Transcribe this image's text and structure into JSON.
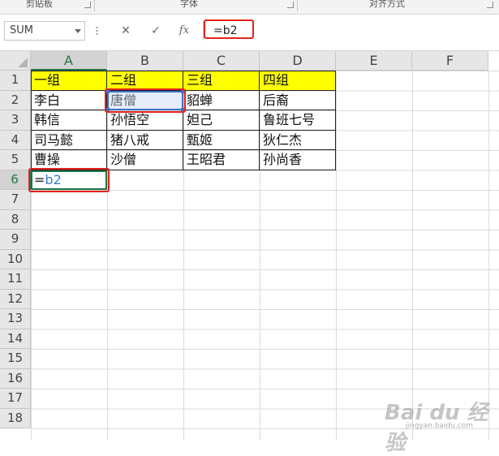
{
  "ribbon": {
    "groups": [
      {
        "label": "剪贴板"
      },
      {
        "label": "字体"
      },
      {
        "label": "对齐方式"
      }
    ]
  },
  "formula_bar": {
    "name_box": "SUM",
    "cancel_icon": "✕",
    "enter_icon": "✓",
    "fx_label": "fx",
    "formula": "=b2"
  },
  "sheet": {
    "columns": [
      "A",
      "B",
      "C",
      "D",
      "E",
      "F"
    ],
    "rows": [
      "1",
      "2",
      "3",
      "4",
      "5",
      "6",
      "7",
      "8",
      "9",
      "10",
      "11",
      "12",
      "13",
      "14",
      "15",
      "16",
      "17",
      "18"
    ],
    "active_column": "A",
    "active_row": "6",
    "table": [
      [
        "一组",
        "二组",
        "三组",
        "四组"
      ],
      [
        "李白",
        "唐僧",
        "貂蝉",
        "后裔"
      ],
      [
        "韩信",
        "孙悟空",
        "妲己",
        "鲁班七号"
      ],
      [
        "司马懿",
        "猪八戒",
        "甄姬",
        "狄仁杰"
      ],
      [
        "曹操",
        "沙僧",
        "王昭君",
        "孙尚香"
      ]
    ],
    "editing_cell": {
      "eq": "=",
      "ref": "b2"
    },
    "header_fill_color": "#ffff00",
    "highlight_color": "#e5221c",
    "reference_color": "#3a73c8"
  },
  "watermark": {
    "text": "Bai du 经验",
    "sub": "jingyan.baidu.com"
  }
}
